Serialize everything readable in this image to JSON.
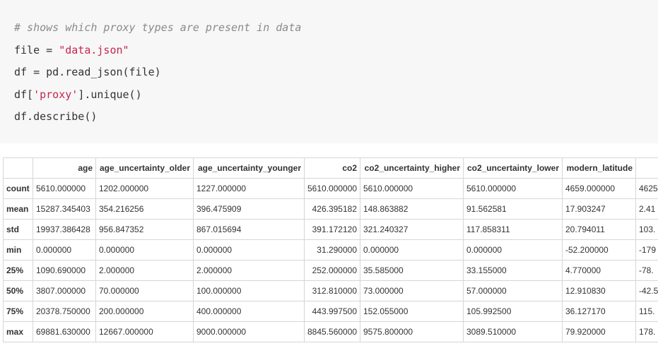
{
  "code": {
    "comment": "# shows which proxy types are present in data",
    "line1_prefix": "file = ",
    "line1_string": "\"data.json\"",
    "line2": "df = pd.read_json(file)",
    "line3_prefix": "df[",
    "line3_string": "'proxy'",
    "line3_suffix": "].unique()",
    "line4": "df.describe()"
  },
  "table": {
    "columns": [
      "",
      "age",
      "age_uncertainty_older",
      "age_uncertainty_younger",
      "co2",
      "co2_uncertainty_higher",
      "co2_uncertainty_lower",
      "modern_latitude",
      "mod"
    ],
    "rows": [
      {
        "index": "count",
        "values": [
          "5610.000000",
          "1202.000000",
          "1227.000000",
          "5610.000000",
          "5610.000000",
          "5610.000000",
          "4659.000000",
          "4625"
        ]
      },
      {
        "index": "mean",
        "values": [
          "15287.345403",
          "354.216256",
          "396.475909",
          "426.395182",
          "148.863882",
          "91.562581",
          "17.903247",
          "2.41"
        ]
      },
      {
        "index": "std",
        "values": [
          "19937.386428",
          "956.847352",
          "867.015694",
          "391.172120",
          "321.240327",
          "117.858311",
          "20.794011",
          "103."
        ]
      },
      {
        "index": "min",
        "values": [
          "0.000000",
          "0.000000",
          "0.000000",
          "31.290000",
          "0.000000",
          "0.000000",
          "-52.200000",
          "-179"
        ]
      },
      {
        "index": "25%",
        "values": [
          "1090.690000",
          "2.000000",
          "2.000000",
          "252.000000",
          "35.585000",
          "33.155000",
          "4.770000",
          "-78."
        ]
      },
      {
        "index": "50%",
        "values": [
          "3807.000000",
          "70.000000",
          "100.000000",
          "312.810000",
          "73.000000",
          "57.000000",
          "12.910830",
          "-42.5"
        ]
      },
      {
        "index": "75%",
        "values": [
          "20378.750000",
          "200.000000",
          "400.000000",
          "443.997500",
          "152.055000",
          "105.992500",
          "36.127170",
          "115."
        ]
      },
      {
        "index": "max",
        "values": [
          "69881.630000",
          "12667.000000",
          "9000.000000",
          "8845.560000",
          "9575.800000",
          "3089.510000",
          "79.920000",
          "178."
        ]
      }
    ]
  }
}
